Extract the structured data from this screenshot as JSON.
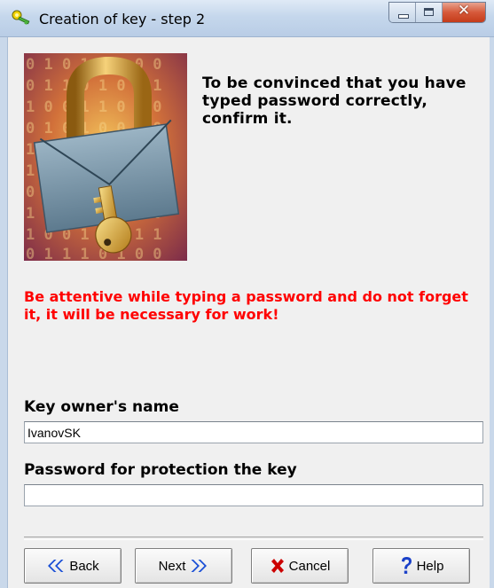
{
  "window": {
    "title": "Creation of key - step 2"
  },
  "content": {
    "info": "To be convinced that you have typed password correctly, confirm it.",
    "warning": "Be attentive while typing a password and do not forget it, it will be necessary for work!"
  },
  "form": {
    "owner_label": "Key owner's name",
    "owner_value": "IvanovSK",
    "password_label": "Password for protection the key",
    "password_value": ""
  },
  "buttons": {
    "back": "Back",
    "next": "Next",
    "cancel": "Cancel",
    "help": "Help"
  },
  "colors": {
    "warning": "#ff0000",
    "arrow_blue": "#1a4fd6",
    "cancel_red": "#cc0000",
    "help_blue": "#1a40c8"
  },
  "icons": [
    "key-app-icon",
    "minimize-icon",
    "maximize-icon",
    "close-icon",
    "lock-envelope-illustration",
    "back-arrow-icon",
    "next-arrow-icon",
    "cancel-x-icon",
    "help-question-icon"
  ]
}
